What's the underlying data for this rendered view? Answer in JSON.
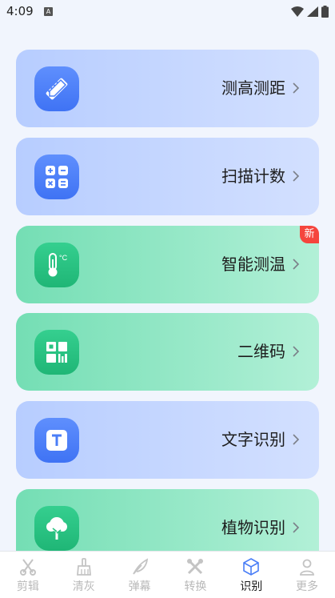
{
  "status": {
    "time": "4:09",
    "notification_glyph": "A"
  },
  "cards": [
    {
      "label": "测高测距",
      "theme": "blue",
      "icon": "ruler-pencil-icon"
    },
    {
      "label": "扫描计数",
      "theme": "blue",
      "icon": "calculator-icon"
    },
    {
      "label": "智能测温",
      "theme": "green",
      "icon": "thermometer-icon",
      "badge": "新"
    },
    {
      "label": "二维码",
      "theme": "green",
      "icon": "qr-code-icon"
    },
    {
      "label": "文字识别",
      "theme": "blue",
      "icon": "text-recognition-icon"
    },
    {
      "label": "植物识别",
      "theme": "green",
      "icon": "tree-icon"
    }
  ],
  "tabs": [
    {
      "label": "剪辑",
      "icon": "scissors-icon",
      "active": false
    },
    {
      "label": "清灰",
      "icon": "brush-icon",
      "active": false
    },
    {
      "label": "弹幕",
      "icon": "feather-icon",
      "active": false
    },
    {
      "label": "转换",
      "icon": "tools-icon",
      "active": false
    },
    {
      "label": "识别",
      "icon": "cube-icon",
      "active": true
    },
    {
      "label": "更多",
      "icon": "user-icon",
      "active": false
    }
  ],
  "colors": {
    "blue_icon": "#4a7ef7",
    "green_icon": "#27c280",
    "badge": "#f5453d",
    "tab_active_icon": "#4a7ef7"
  }
}
